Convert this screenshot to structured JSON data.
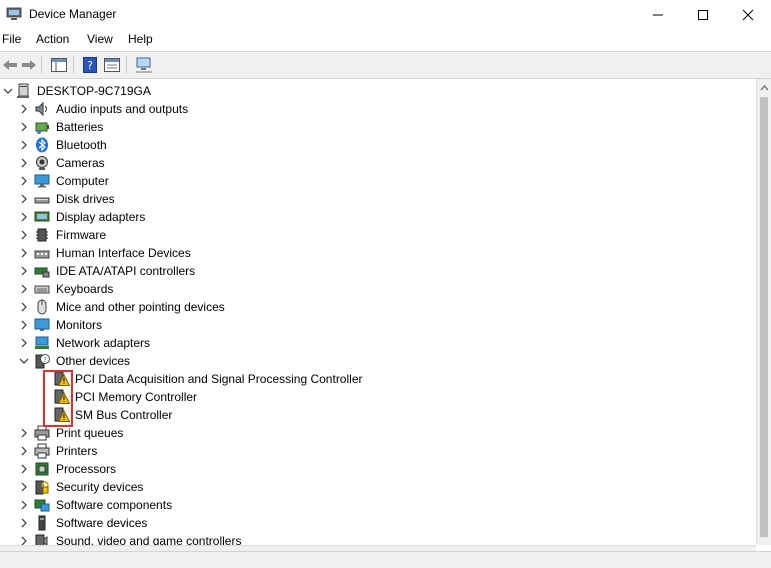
{
  "window": {
    "title": "Device Manager"
  },
  "menu": {
    "items": [
      "File",
      "Action",
      "View",
      "Help"
    ]
  },
  "tree": {
    "root": "DESKTOP-9C719GA",
    "categories": [
      {
        "label": "Audio inputs and outputs",
        "icon": "speaker-icon"
      },
      {
        "label": "Batteries",
        "icon": "battery-icon"
      },
      {
        "label": "Bluetooth",
        "icon": "bluetooth-icon"
      },
      {
        "label": "Cameras",
        "icon": "camera-icon"
      },
      {
        "label": "Computer",
        "icon": "computer-icon"
      },
      {
        "label": "Disk drives",
        "icon": "disk-drive-icon"
      },
      {
        "label": "Display adapters",
        "icon": "display-adapter-icon"
      },
      {
        "label": "Firmware",
        "icon": "firmware-icon"
      },
      {
        "label": "Human Interface Devices",
        "icon": "hid-icon"
      },
      {
        "label": "IDE ATA/ATAPI controllers",
        "icon": "ide-controller-icon"
      },
      {
        "label": "Keyboards",
        "icon": "keyboard-icon"
      },
      {
        "label": "Mice and other pointing devices",
        "icon": "mouse-icon"
      },
      {
        "label": "Monitors",
        "icon": "monitor-icon"
      },
      {
        "label": "Network adapters",
        "icon": "network-adapter-icon"
      },
      {
        "label": "Other devices",
        "icon": "unknown-device-icon",
        "expanded": true,
        "children": [
          {
            "label": "PCI Data Acquisition and Signal Processing Controller",
            "icon": "warning-device-icon"
          },
          {
            "label": "PCI Memory Controller",
            "icon": "warning-device-icon"
          },
          {
            "label": "SM Bus Controller",
            "icon": "warning-device-icon"
          }
        ]
      },
      {
        "label": "Print queues",
        "icon": "print-queue-icon"
      },
      {
        "label": "Printers",
        "icon": "printer-icon"
      },
      {
        "label": "Processors",
        "icon": "processor-icon"
      },
      {
        "label": "Security devices",
        "icon": "security-device-icon"
      },
      {
        "label": "Software components",
        "icon": "software-component-icon"
      },
      {
        "label": "Software devices",
        "icon": "software-device-icon"
      },
      {
        "label": "Sound, video and game controllers",
        "icon": "sound-controller-icon"
      }
    ]
  },
  "colors": {
    "warning": "#f5c400",
    "highlight": "#d9312b",
    "accent": "#1e6fd9"
  }
}
